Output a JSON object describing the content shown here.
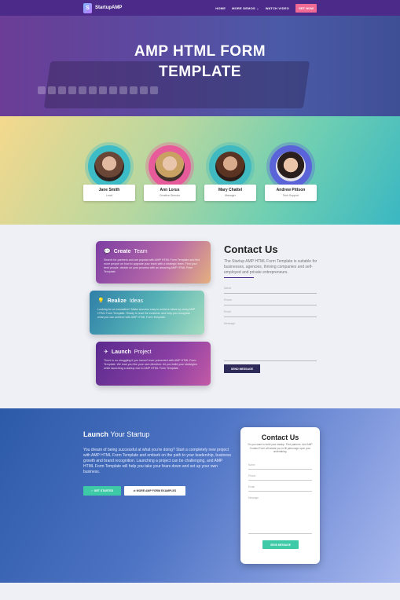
{
  "nav": {
    "brand": "StartupAMP",
    "links": [
      "HOME",
      "MORE DEMOS ⌄",
      "WATCH VIDEO"
    ],
    "cta": "GET NOW"
  },
  "hero": {
    "title_line1": "AMP HTML FORM",
    "title_line2": "TEMPLATE"
  },
  "team": [
    {
      "name": "Jane Smith",
      "role": "Lead",
      "ring": "#3bbcc6"
    },
    {
      "name": "Ann Lorus",
      "role": "Creative Director",
      "ring": "#e85b9a"
    },
    {
      "name": "Mary Chattel",
      "role": "Manager",
      "ring": "#41b9c0"
    },
    {
      "name": "Andrew Pittson",
      "role": "Tech Support",
      "ring": "#5a63d8"
    }
  ],
  "features": [
    {
      "icon": "chat-icon",
      "bold": "Create",
      "light": "Team",
      "text": "Search for partners and are popular with AMP HTML Form Template and find more people on how to upgrade your team with a strategic team. Find your best people, decide on your process with an amazing AMP HTML Form Template."
    },
    {
      "icon": "bulb-icon",
      "bold": "Realize",
      "light": "Ideas",
      "text": "Looking for an innovative? Make success easy to achieve ideas by using AMP HTML Form Template. Ready to lead the evolution and help you recognize what you can achieve with AMP HTML Form Template."
    },
    {
      "icon": "plane-icon",
      "bold": "Launch",
      "light": "Project",
      "text": "There is no struggling if you haven't ever presented with AMP HTML Form Template. We lead you like your own direction: let you build your strategies while launching a startup due to AMP HTML Form Template."
    }
  ],
  "contact": {
    "title": "Contact Us",
    "text": "The Startup AMP HTML Form Template is suitable for businesses, agencies, thriving companies and self-employed and private entrepreneurs.",
    "fields": [
      "Name",
      "Phone",
      "Email",
      "Message"
    ],
    "send": "SEND MESSAGE"
  },
  "launch": {
    "title_bold": "Launch",
    "title_light": "Your Startup",
    "desc": "You dream of being successful at what you're doing? Start a completely new project with AMP HTML Form Template and embark on the path to your leadership, business growth and brand recognition. Launching a project can be challenging, and AMP HTML Form Template will help you take your fears down and set up your own business.",
    "btn1": "✓ GET STARTED",
    "btn2": "⇄ MORE AMP FORM EXAMPLES",
    "form_title": "Contact Us",
    "form_desc": "Do you want to build your startup. Find partners. And AMP Contact Form will assist you to fill patronage upon your undertaking.",
    "form_fields": [
      "Name",
      "Phone",
      "Email",
      "Message"
    ],
    "form_send": "SEND MESSAGE"
  }
}
